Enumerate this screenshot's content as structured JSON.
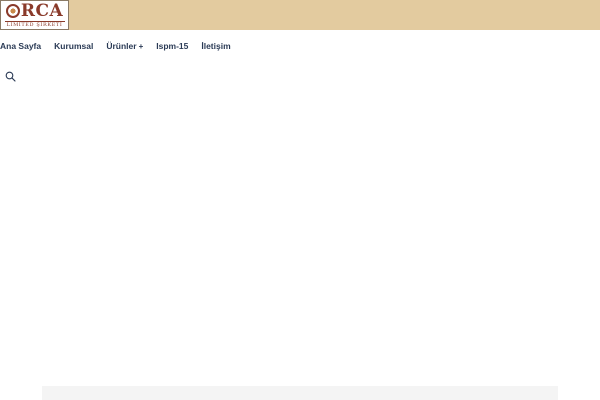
{
  "logo": {
    "word": "RCA",
    "subtitle": "LİMİTED ŞİRKETİ"
  },
  "nav": {
    "items": [
      {
        "label": "Ana Sayfa"
      },
      {
        "label": "Kurumsal"
      },
      {
        "label": "Ürünler",
        "has_submenu": true
      },
      {
        "label": "Ispm-15"
      },
      {
        "label": "İletişim"
      }
    ],
    "submenu_indicator": "+"
  },
  "colors": {
    "topbar": "#e3cb9f",
    "nav_text": "#2a3a55",
    "logo_brand": "#8a3a2a"
  },
  "icons": {
    "search": "search-icon"
  }
}
